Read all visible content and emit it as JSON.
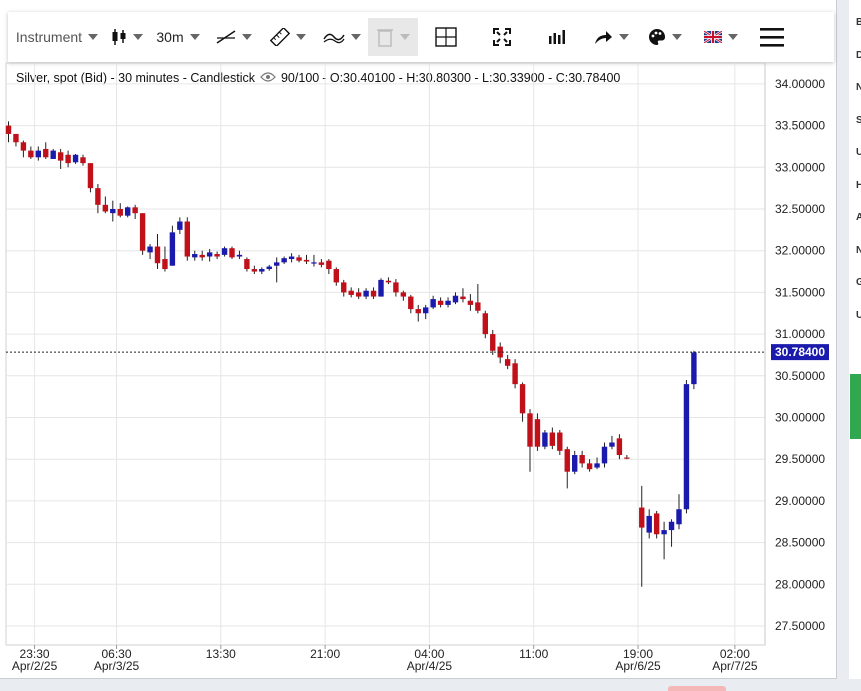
{
  "toolbar": {
    "instrument_label": "Instrument",
    "interval_label": "30m",
    "icons": [
      "candlestick-icon",
      "draw-line-icon",
      "ruler-icon",
      "indicator-icon",
      "trash-icon",
      "layout-icon",
      "fullscreen-icon",
      "volume-icon",
      "share-arrow-icon",
      "palette-icon",
      "uk-flag-icon",
      "hamburger-menu-icon"
    ]
  },
  "chart_info": {
    "instrument": "Silver, spot (Bid) - 30 minutes - Candlestick",
    "visible": "90/100",
    "ohlc": "- O:30.40100 - H:30.80300 - L:30.33900 - C:30.78400"
  },
  "colors": {
    "up": "#1a1aad",
    "down": "#c0111b",
    "grid": "#e6e6e6",
    "price_tag": "#1a1aad"
  },
  "chart_data": {
    "type": "candlestick",
    "ylim": [
      27.3,
      34.2
    ],
    "yticks": [
      {
        "v": 34.0,
        "label": "34.00000"
      },
      {
        "v": 33.5,
        "label": "33.50000"
      },
      {
        "v": 33.0,
        "label": "33.00000"
      },
      {
        "v": 32.5,
        "label": "32.50000"
      },
      {
        "v": 32.0,
        "label": "32.00000"
      },
      {
        "v": 31.5,
        "label": "31.50000"
      },
      {
        "v": 31.0,
        "label": "31.00000"
      },
      {
        "v": 30.5,
        "label": "30.50000"
      },
      {
        "v": 30.0,
        "label": "30.00000"
      },
      {
        "v": 29.5,
        "label": "29.50000"
      },
      {
        "v": 29.0,
        "label": "29.00000"
      },
      {
        "v": 28.5,
        "label": "28.50000"
      },
      {
        "v": 28.0,
        "label": "28.00000"
      },
      {
        "v": 27.5,
        "label": "27.50000"
      }
    ],
    "xticks": [
      {
        "i": 3.5,
        "time": "23:30",
        "date": "Apr/2/25"
      },
      {
        "i": 14.5,
        "time": "06:30",
        "date": "Apr/3/25"
      },
      {
        "i": 28.5,
        "time": "13:30",
        "date": ""
      },
      {
        "i": 42.5,
        "time": "21:00",
        "date": ""
      },
      {
        "i": 56.5,
        "time": "04:00",
        "date": "Apr/4/25"
      },
      {
        "i": 70.5,
        "time": "11:00",
        "date": ""
      },
      {
        "i": 84.5,
        "time": "19:00",
        "date": "Apr/6/25"
      },
      {
        "i": 97.5,
        "time": "02:00",
        "date": "Apr/7/25"
      }
    ],
    "last_price": {
      "value": 30.784,
      "label": "30.78400"
    },
    "candles": [
      {
        "i": 0,
        "o": 33.5,
        "h": 33.55,
        "l": 33.3,
        "c": 33.4
      },
      {
        "i": 1,
        "o": 33.4,
        "h": 33.4,
        "l": 33.25,
        "c": 33.3
      },
      {
        "i": 2,
        "o": 33.3,
        "h": 33.32,
        "l": 33.12,
        "c": 33.2
      },
      {
        "i": 3,
        "o": 33.2,
        "h": 33.25,
        "l": 33.1,
        "c": 33.12
      },
      {
        "i": 4,
        "o": 33.12,
        "h": 33.25,
        "l": 33.08,
        "c": 33.2
      },
      {
        "i": 5,
        "o": 33.22,
        "h": 33.3,
        "l": 33.1,
        "c": 33.12
      },
      {
        "i": 6,
        "o": 33.1,
        "h": 33.22,
        "l": 33.1,
        "c": 33.2
      },
      {
        "i": 7,
        "o": 33.18,
        "h": 33.22,
        "l": 32.98,
        "c": 33.08
      },
      {
        "i": 8,
        "o": 33.15,
        "h": 33.2,
        "l": 33.0,
        "c": 33.05
      },
      {
        "i": 9,
        "o": 33.06,
        "h": 33.16,
        "l": 33.04,
        "c": 33.15
      },
      {
        "i": 10,
        "o": 33.12,
        "h": 33.15,
        "l": 33.02,
        "c": 33.05
      },
      {
        "i": 11,
        "o": 33.05,
        "h": 33.05,
        "l": 32.7,
        "c": 32.75
      },
      {
        "i": 12,
        "o": 32.75,
        "h": 32.8,
        "l": 32.45,
        "c": 32.55
      },
      {
        "i": 13,
        "o": 32.55,
        "h": 32.65,
        "l": 32.45,
        "c": 32.47
      },
      {
        "i": 14,
        "o": 32.45,
        "h": 32.6,
        "l": 32.35,
        "c": 32.5
      },
      {
        "i": 15,
        "o": 32.5,
        "h": 32.57,
        "l": 32.4,
        "c": 32.42
      },
      {
        "i": 16,
        "o": 32.42,
        "h": 32.53,
        "l": 32.4,
        "c": 32.52
      },
      {
        "i": 17,
        "o": 32.52,
        "h": 32.55,
        "l": 32.38,
        "c": 32.45
      },
      {
        "i": 18,
        "o": 32.45,
        "h": 32.45,
        "l": 31.95,
        "c": 32.0
      },
      {
        "i": 19,
        "o": 31.98,
        "h": 32.08,
        "l": 31.9,
        "c": 32.05
      },
      {
        "i": 20,
        "o": 32.05,
        "h": 32.2,
        "l": 31.78,
        "c": 31.85
      },
      {
        "i": 21,
        "o": 31.9,
        "h": 32.05,
        "l": 31.75,
        "c": 31.78
      },
      {
        "i": 22,
        "o": 31.82,
        "h": 32.3,
        "l": 31.82,
        "c": 32.22
      },
      {
        "i": 23,
        "o": 32.25,
        "h": 32.4,
        "l": 32.2,
        "c": 32.35
      },
      {
        "i": 24,
        "o": 32.35,
        "h": 32.4,
        "l": 31.88,
        "c": 31.93
      },
      {
        "i": 25,
        "o": 31.92,
        "h": 32.0,
        "l": 31.88,
        "c": 31.96
      },
      {
        "i": 26,
        "o": 31.95,
        "h": 32.0,
        "l": 31.88,
        "c": 31.92
      },
      {
        "i": 27,
        "o": 31.93,
        "h": 32.02,
        "l": 31.87,
        "c": 31.98
      },
      {
        "i": 28,
        "o": 31.96,
        "h": 31.99,
        "l": 31.9,
        "c": 31.93
      },
      {
        "i": 29,
        "o": 31.95,
        "h": 32.05,
        "l": 31.93,
        "c": 32.03
      },
      {
        "i": 30,
        "o": 32.03,
        "h": 32.05,
        "l": 31.9,
        "c": 31.92
      },
      {
        "i": 31,
        "o": 31.93,
        "h": 32.0,
        "l": 31.9,
        "c": 31.95
      },
      {
        "i": 32,
        "o": 31.9,
        "h": 31.92,
        "l": 31.75,
        "c": 31.78
      },
      {
        "i": 33,
        "o": 31.78,
        "h": 31.82,
        "l": 31.72,
        "c": 31.75
      },
      {
        "i": 34,
        "o": 31.75,
        "h": 31.8,
        "l": 31.72,
        "c": 31.78
      },
      {
        "i": 35,
        "o": 31.78,
        "h": 31.83,
        "l": 31.76,
        "c": 31.81
      },
      {
        "i": 36,
        "o": 31.82,
        "h": 31.92,
        "l": 31.62,
        "c": 31.86
      },
      {
        "i": 37,
        "o": 31.86,
        "h": 31.93,
        "l": 31.84,
        "c": 31.91
      },
      {
        "i": 38,
        "o": 31.9,
        "h": 31.97,
        "l": 31.86,
        "c": 31.93
      },
      {
        "i": 39,
        "o": 31.92,
        "h": 31.95,
        "l": 31.86,
        "c": 31.88
      },
      {
        "i": 40,
        "o": 31.89,
        "h": 31.95,
        "l": 31.84,
        "c": 31.87
      },
      {
        "i": 41,
        "o": 31.85,
        "h": 31.95,
        "l": 31.81,
        "c": 31.86
      },
      {
        "i": 42,
        "o": 31.86,
        "h": 31.9,
        "l": 31.8,
        "c": 31.83
      },
      {
        "i": 43,
        "o": 31.88,
        "h": 31.9,
        "l": 31.72,
        "c": 31.78
      },
      {
        "i": 44,
        "o": 31.78,
        "h": 31.8,
        "l": 31.58,
        "c": 31.62
      },
      {
        "i": 45,
        "o": 31.62,
        "h": 31.65,
        "l": 31.45,
        "c": 31.5
      },
      {
        "i": 46,
        "o": 31.52,
        "h": 31.56,
        "l": 31.44,
        "c": 31.47
      },
      {
        "i": 47,
        "o": 31.5,
        "h": 31.55,
        "l": 31.42,
        "c": 31.45
      },
      {
        "i": 48,
        "o": 31.45,
        "h": 31.55,
        "l": 31.42,
        "c": 31.52
      },
      {
        "i": 49,
        "o": 31.52,
        "h": 31.56,
        "l": 31.42,
        "c": 31.45
      },
      {
        "i": 50,
        "o": 31.45,
        "h": 31.67,
        "l": 31.45,
        "c": 31.65
      },
      {
        "i": 51,
        "o": 31.64,
        "h": 31.68,
        "l": 31.6,
        "c": 31.62
      },
      {
        "i": 52,
        "o": 31.62,
        "h": 31.66,
        "l": 31.45,
        "c": 31.5
      },
      {
        "i": 53,
        "o": 31.5,
        "h": 31.52,
        "l": 31.4,
        "c": 31.45
      },
      {
        "i": 54,
        "o": 31.45,
        "h": 31.47,
        "l": 31.25,
        "c": 31.3
      },
      {
        "i": 55,
        "o": 31.3,
        "h": 31.35,
        "l": 31.15,
        "c": 31.25
      },
      {
        "i": 56,
        "o": 31.25,
        "h": 31.35,
        "l": 31.18,
        "c": 31.32
      },
      {
        "i": 57,
        "o": 31.32,
        "h": 31.46,
        "l": 31.3,
        "c": 31.42
      },
      {
        "i": 58,
        "o": 31.4,
        "h": 31.44,
        "l": 31.32,
        "c": 31.35
      },
      {
        "i": 59,
        "o": 31.35,
        "h": 31.44,
        "l": 31.32,
        "c": 31.4
      },
      {
        "i": 60,
        "o": 31.38,
        "h": 31.5,
        "l": 31.36,
        "c": 31.46
      },
      {
        "i": 61,
        "o": 31.45,
        "h": 31.55,
        "l": 31.38,
        "c": 31.42
      },
      {
        "i": 62,
        "o": 31.4,
        "h": 31.48,
        "l": 31.28,
        "c": 31.35
      },
      {
        "i": 63,
        "o": 31.38,
        "h": 31.6,
        "l": 31.25,
        "c": 31.28
      },
      {
        "i": 64,
        "o": 31.25,
        "h": 31.28,
        "l": 30.95,
        "c": 31.0
      },
      {
        "i": 65,
        "o": 31.0,
        "h": 31.05,
        "l": 30.75,
        "c": 30.8
      },
      {
        "i": 66,
        "o": 30.85,
        "h": 30.9,
        "l": 30.65,
        "c": 30.72
      },
      {
        "i": 67,
        "o": 30.7,
        "h": 30.75,
        "l": 30.58,
        "c": 30.62
      },
      {
        "i": 68,
        "o": 30.65,
        "h": 30.7,
        "l": 30.35,
        "c": 30.4
      },
      {
        "i": 69,
        "o": 30.4,
        "h": 30.42,
        "l": 29.95,
        "c": 30.05
      },
      {
        "i": 70,
        "o": 30.05,
        "h": 30.1,
        "l": 29.35,
        "c": 29.65
      },
      {
        "i": 71,
        "o": 29.98,
        "h": 30.05,
        "l": 29.6,
        "c": 29.65
      },
      {
        "i": 72,
        "o": 29.65,
        "h": 29.85,
        "l": 29.62,
        "c": 29.82
      },
      {
        "i": 73,
        "o": 29.82,
        "h": 29.88,
        "l": 29.62,
        "c": 29.66
      },
      {
        "i": 74,
        "o": 29.82,
        "h": 29.85,
        "l": 29.55,
        "c": 29.6
      },
      {
        "i": 75,
        "o": 29.62,
        "h": 29.65,
        "l": 29.15,
        "c": 29.35
      },
      {
        "i": 76,
        "o": 29.35,
        "h": 29.6,
        "l": 29.32,
        "c": 29.55
      },
      {
        "i": 77,
        "o": 29.55,
        "h": 29.6,
        "l": 29.4,
        "c": 29.45
      },
      {
        "i": 78,
        "o": 29.45,
        "h": 29.5,
        "l": 29.35,
        "c": 29.38
      },
      {
        "i": 79,
        "o": 29.4,
        "h": 29.52,
        "l": 29.38,
        "c": 29.45
      },
      {
        "i": 80,
        "o": 29.45,
        "h": 29.7,
        "l": 29.4,
        "c": 29.65
      },
      {
        "i": 81,
        "o": 29.65,
        "h": 29.78,
        "l": 29.62,
        "c": 29.7
      },
      {
        "i": 82,
        "o": 29.75,
        "h": 29.8,
        "l": 29.5,
        "c": 29.55
      },
      {
        "i": 83,
        "o": 29.52,
        "h": 29.55,
        "l": 29.5,
        "c": 29.51
      },
      {
        "i": 85,
        "o": 28.92,
        "h": 29.18,
        "l": 27.97,
        "c": 28.68
      },
      {
        "i": 86,
        "o": 28.62,
        "h": 28.9,
        "l": 28.55,
        "c": 28.82
      },
      {
        "i": 87,
        "o": 28.85,
        "h": 28.88,
        "l": 28.55,
        "c": 28.6
      },
      {
        "i": 88,
        "o": 28.6,
        "h": 28.75,
        "l": 28.3,
        "c": 28.65
      },
      {
        "i": 89,
        "o": 28.65,
        "h": 28.78,
        "l": 28.45,
        "c": 28.75
      },
      {
        "i": 90,
        "o": 28.72,
        "h": 29.08,
        "l": 28.66,
        "c": 28.9
      },
      {
        "i": 91,
        "o": 28.9,
        "h": 30.45,
        "l": 28.85,
        "c": 30.4
      },
      {
        "i": 92,
        "o": 30.4,
        "h": 30.8,
        "l": 30.34,
        "c": 30.78
      }
    ]
  },
  "right_strip_letters": [
    "B",
    "D",
    "N",
    "S",
    "U",
    "H",
    "A",
    "N",
    "G",
    "U"
  ]
}
